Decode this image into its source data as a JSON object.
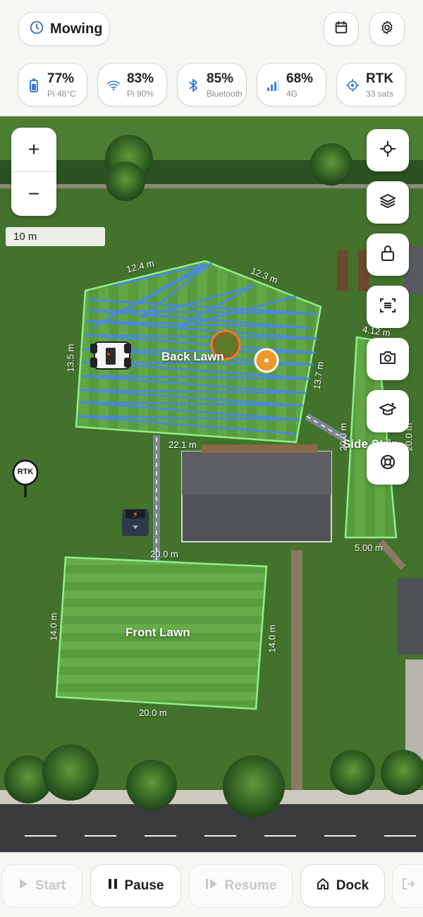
{
  "header": {
    "status_label": "Mowing",
    "stats": [
      {
        "icon": "battery-icon",
        "value": "77%",
        "sub": "Pi 48°C"
      },
      {
        "icon": "wifi-icon",
        "value": "83%",
        "sub": "Pi 90%"
      },
      {
        "icon": "bluetooth-icon",
        "value": "85%",
        "sub": "Bluetooth"
      },
      {
        "icon": "cellular-icon",
        "value": "68%",
        "sub": "4G"
      },
      {
        "icon": "gps-target-icon",
        "value": "RTK",
        "sub": "33 sats"
      }
    ]
  },
  "map": {
    "scale_label": "10 m",
    "zoom_in": "+",
    "zoom_out": "−",
    "rtk_marker": "RTK",
    "zones": {
      "back_lawn": "Back Lawn",
      "front_lawn": "Front Lawn",
      "side_strip": "Side Strip"
    },
    "dimensions": {
      "back_top_left": "12.4 m",
      "back_top_right": "12.3 m",
      "back_left": "13.5 m",
      "back_right": "13.7 m",
      "back_bottom": "22.1 m",
      "side_top": "4.12 m",
      "side_left": "20.0 m",
      "side_right": "20.0 m",
      "side_bottom": "5.00 m",
      "front_top": "20.0 m",
      "front_left": "14.0 m",
      "front_right": "14.0 m",
      "front_bottom": "20.0 m"
    }
  },
  "actions": {
    "start": "Start",
    "pause": "Pause",
    "resume": "Resume",
    "dock": "Dock"
  },
  "colors": {
    "accent_blue": "#3b7ddd",
    "zone_outline": "#8ff08a",
    "path_blue": "#4a86e8",
    "target_orange": "#f0972a"
  }
}
